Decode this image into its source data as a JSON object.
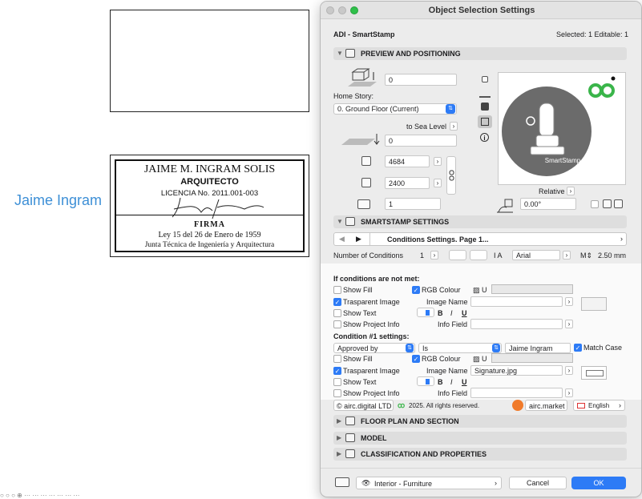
{
  "canvas": {
    "label": "Jaime Ingram",
    "stamp": {
      "line1": "JAIME M. INGRAM SOLIS",
      "line2": "ARQUITECTO",
      "line3": "LICENCIA No. 2011.001-003",
      "line4": "FIRMA",
      "line5": "Ley 15 del 26 de Enero de 1959",
      "line6": "Junta Técnica de Ingeniería y Arquitectura"
    }
  },
  "dialog": {
    "title": "Object Selection Settings",
    "object_name": "ADI - SmartStamp",
    "selected_info": "Selected: 1 Editable: 1",
    "preview_section": {
      "title": "PREVIEW AND POSITIONING",
      "elevation_value": "0",
      "home_story_label": "Home Story:",
      "home_story_value": "0. Ground Floor (Current)",
      "sea_level_label": "to Sea Level",
      "sea_level_value": "0",
      "width_value": "4684",
      "depth_value": "2400",
      "height_value": "1",
      "relative_label": "Relative",
      "angle_value": "0.00°",
      "preview_caption": "SmartStamp"
    },
    "smartstamp_section": {
      "title": "SMARTSTAMP SETTINGS",
      "page_label": "Conditions Settings. Page 1...",
      "num_conditions_label": "Number of Conditions",
      "num_conditions_value": "1",
      "font_value": "Arial",
      "text_size_value": "2.50 mm",
      "not_met_heading": "If conditions are not met:",
      "show_fill": "Show Fill",
      "rgb_colour": "RGB Colour",
      "transparent_image": "Trasparent Image",
      "image_name_label": "Image Name",
      "show_text": "Show Text",
      "show_project_info": "Show Project Info",
      "info_field_label": "Info Field",
      "condition_heading": "Condition #1 settings:",
      "condition_param": "Approved by",
      "condition_op": "Is",
      "condition_value": "Jaime Ingram",
      "match_case": "Match Case",
      "image_name_value": "Signature.jpg",
      "vendor": "© airc.digital LTD",
      "copyright": "2025. All rights reserved.",
      "market": "airc.market",
      "language": "English"
    },
    "collapsed_sections": [
      "FLOOR PLAN AND SECTION",
      "MODEL",
      "CLASSIFICATION AND PROPERTIES"
    ],
    "layer_value": "Interior - Furniture",
    "cancel_label": "Cancel",
    "ok_label": "OK",
    "colors": {
      "accent": "#2d7bf6",
      "logo_green": "#3ab54a",
      "preview_disk": "#6b6b6b"
    }
  }
}
